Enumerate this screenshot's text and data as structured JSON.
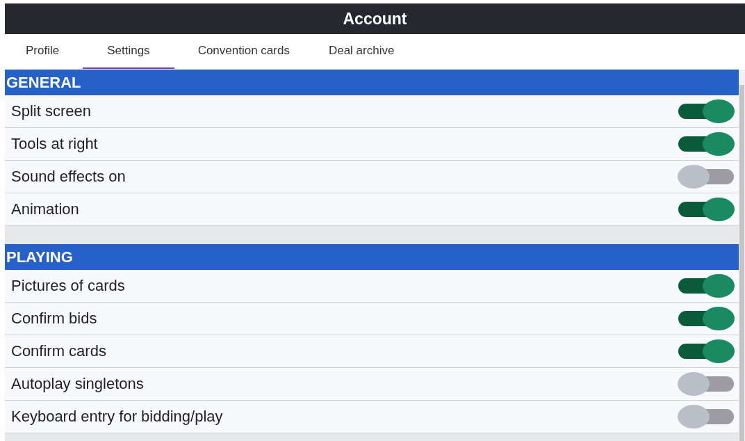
{
  "window": {
    "title": "Account"
  },
  "tabs": [
    {
      "label": "Profile",
      "selected": false
    },
    {
      "label": "Settings",
      "selected": true
    },
    {
      "label": "Convention cards",
      "selected": false
    },
    {
      "label": "Deal archive",
      "selected": false
    }
  ],
  "sections": [
    {
      "title": "GENERAL",
      "settings": [
        {
          "label": "Split screen",
          "on": true
        },
        {
          "label": "Tools at right",
          "on": true
        },
        {
          "label": "Sound effects on",
          "on": false
        },
        {
          "label": "Animation",
          "on": true
        }
      ]
    },
    {
      "title": "PLAYING",
      "settings": [
        {
          "label": "Pictures of cards",
          "on": true
        },
        {
          "label": "Confirm bids",
          "on": true
        },
        {
          "label": "Confirm cards",
          "on": true
        },
        {
          "label": "Autoplay singletons",
          "on": false
        },
        {
          "label": "Keyboard entry for bidding/play",
          "on": false
        }
      ]
    }
  ]
}
